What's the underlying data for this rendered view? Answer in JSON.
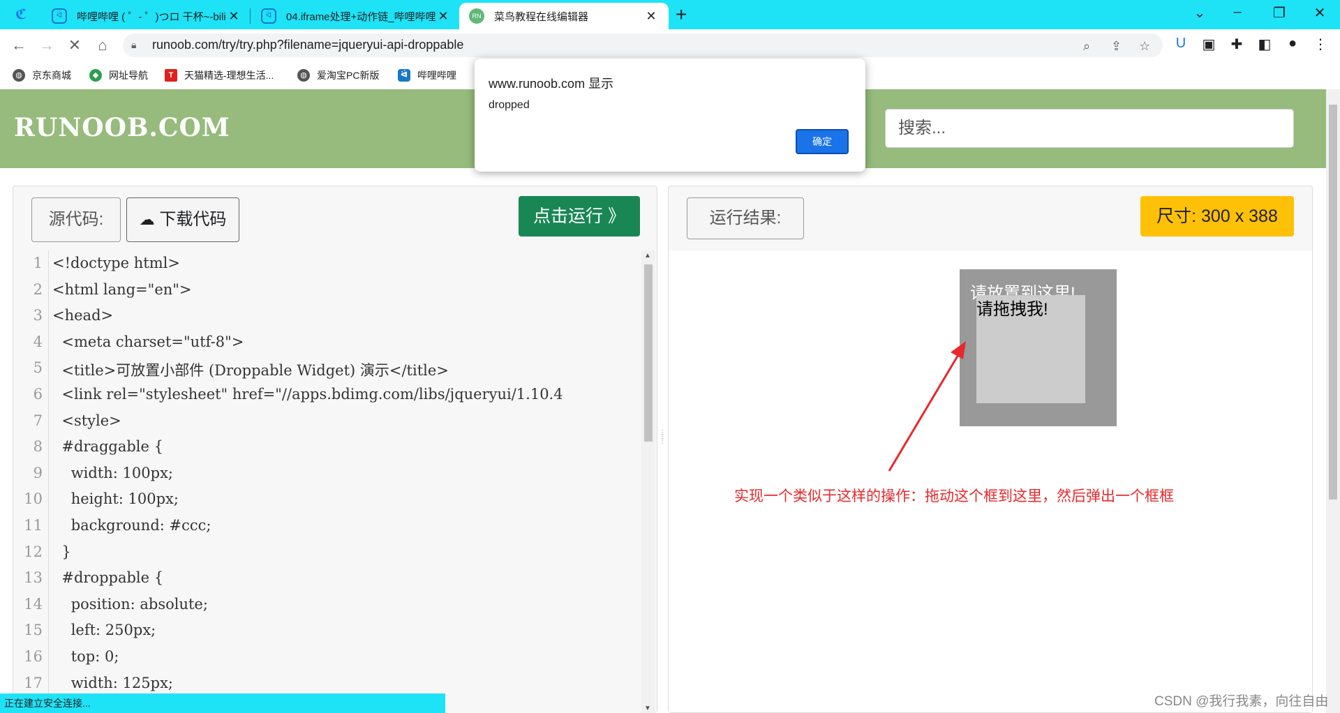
{
  "browser": {
    "tabs": [
      {
        "title": "哔哩哔哩 ( ゜- ゜)つロ 干杯~-bilibili",
        "favicon": "bilibili-icon",
        "active": false
      },
      {
        "title": "04.iframe处理+动作链_哔哩哔哩",
        "favicon": "bilibili-icon",
        "active": false
      },
      {
        "title": "菜鸟教程在线编辑器",
        "favicon": "runoob-icon",
        "active": true
      }
    ],
    "url": "runoob.com/try/try.php?filename=jqueryui-api-droppable",
    "bookmarks": [
      "京东商城",
      "网址导航",
      "天猫精选-理想生活...",
      "爱淘宝PC新版",
      "哔哩哔哩"
    ],
    "status_text": "正在建立安全连接...",
    "accent": "#1ee3f7"
  },
  "site": {
    "logo": "RUNOOB.COM",
    "search_placeholder": "搜索...",
    "header_color": "#96bb7c"
  },
  "editor": {
    "source_label": "源代码:",
    "download_label": "下载代码",
    "run_label": "点击运行 》",
    "line_numbers": [
      "1",
      "2",
      "3",
      "4",
      "5",
      "6",
      "7",
      "8",
      "9",
      "10",
      "11",
      "12",
      "13",
      "14",
      "15",
      "16",
      "17"
    ],
    "lines": [
      "<!doctype html>",
      "<html lang=\"en\">",
      "<head>",
      "  <meta charset=\"utf-8\">",
      "  <title>可放置小部件 (Droppable Widget) 演示</title>",
      "  <link rel=\"stylesheet\" href=\"//apps.bdimg.com/libs/jqueryui/1.10.4",
      "  <style>",
      "  #draggable {",
      "    width: 100px;",
      "    height: 100px;",
      "    background: #ccc;",
      "  }",
      "  #droppable {",
      "    position: absolute;",
      "    left: 250px;",
      "    top: 0;",
      "    width: 125px;"
    ]
  },
  "result": {
    "label": "运行结果:",
    "size_label": "尺寸: 300 x 388",
    "droppable_text": "请放置到这里!",
    "draggable_text": "请拖拽我!",
    "annotation": "实现一个类似于这样的操作：拖动这个框到这里，然后弹出一个框框"
  },
  "dialog": {
    "title": "www.runoob.com 显示",
    "message": "dropped",
    "ok_label": "确定"
  },
  "watermark": "CSDN @我行我素，向往自由"
}
